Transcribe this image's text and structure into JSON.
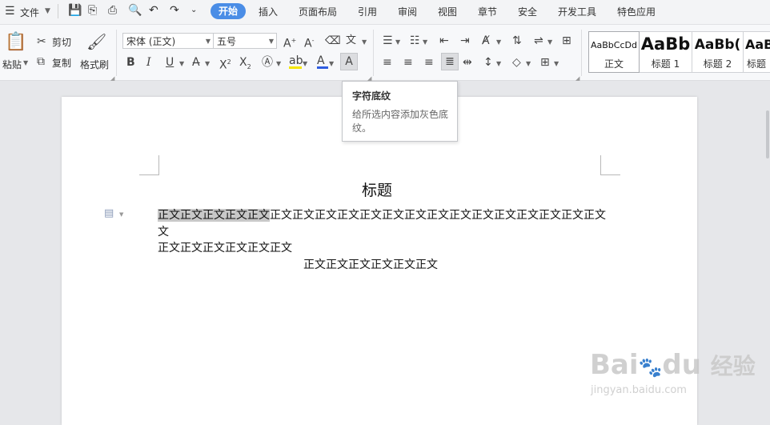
{
  "menu": {
    "file_label": "文件",
    "tabs": [
      "开始",
      "插入",
      "页面布局",
      "引用",
      "审阅",
      "视图",
      "章节",
      "安全",
      "开发工具",
      "特色应用"
    ],
    "active_tab": "开始"
  },
  "ribbon": {
    "paste_label": "粘贴",
    "cut_label": "剪切",
    "copy_label": "复制",
    "format_painter_label": "格式刷",
    "font_name": "宋体 (正文)",
    "font_size": "五号",
    "styles": [
      {
        "preview": "AaBbCcDd",
        "name": "正文"
      },
      {
        "preview": "AaBb",
        "name": "标题 1"
      },
      {
        "preview": "AaBb(",
        "name": "标题 2"
      },
      {
        "preview": "AaB",
        "name": "标题"
      }
    ]
  },
  "tooltip": {
    "title": "字符底纹",
    "description": "给所选内容添加灰色底纹。"
  },
  "document": {
    "heading": "标题",
    "para1_highlighted": "正文正文正文正文正文",
    "para1_rest": "正文正文正文正文正文正文正文正文正文正文正文正文正文正文正文",
    "para1_wrap": "文",
    "para2": "正文正文正文正文正文正文",
    "para3": "正文正文正文正文正文正文"
  },
  "watermark": {
    "brand": "Bai",
    "brand2": "du",
    "experience": "经验",
    "url": "jingyan.baidu.com"
  },
  "colors": {
    "accent": "#4a8de6",
    "char_shading": "#c8c8c8",
    "font_color_bar": "#2f5de0",
    "highlight_bar": "#f5e600"
  }
}
